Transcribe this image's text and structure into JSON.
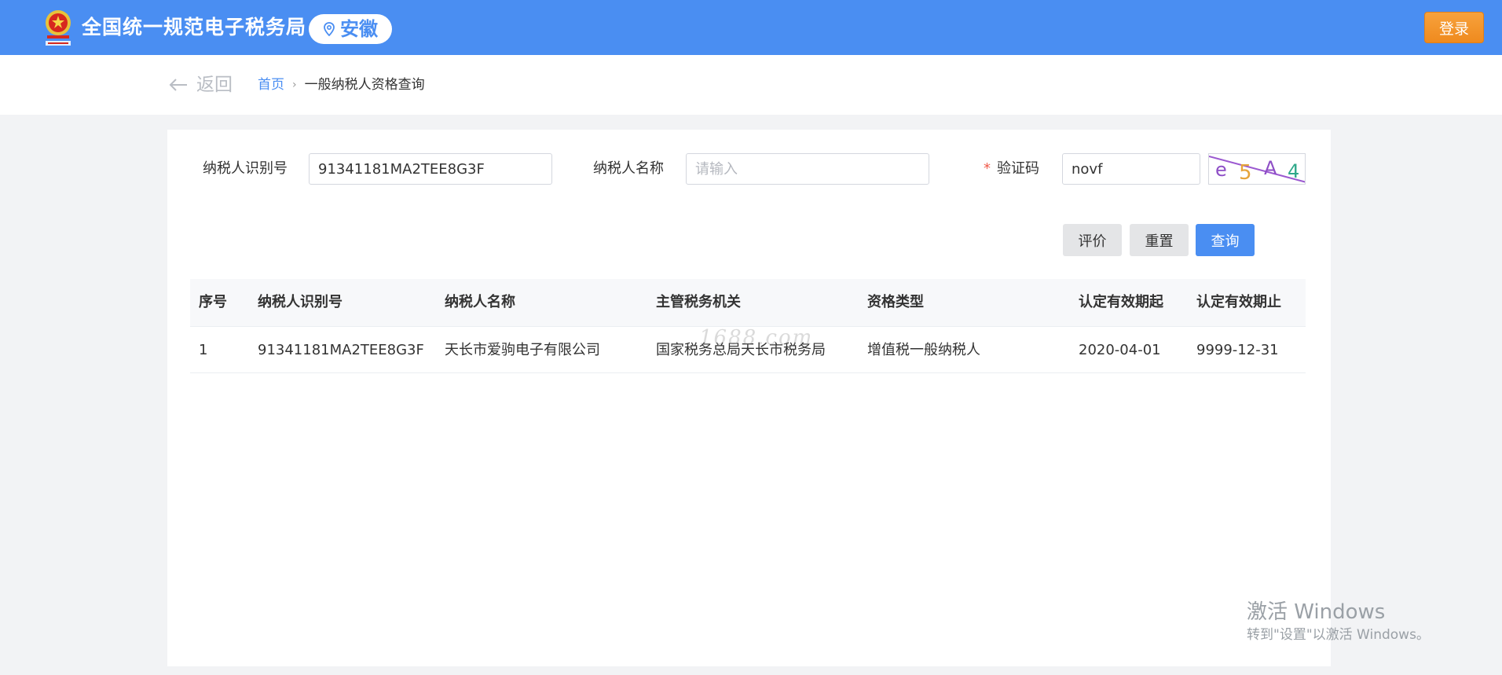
{
  "header": {
    "site_title": "全国统一规范电子税务局",
    "region": "安徽",
    "login_label": "登录"
  },
  "nav": {
    "back_label": "返回",
    "home_label": "首页",
    "separator": "›",
    "current_label": "一般纳税人资格查询"
  },
  "form": {
    "taxpayer_id_label": "纳税人识别号",
    "taxpayer_id_value": "91341181MA2TEE8G3F",
    "taxpayer_name_label": "纳税人名称",
    "taxpayer_name_placeholder": "请输入",
    "required_mark": "*",
    "captcha_label": "验证码",
    "captcha_value": "novf",
    "captcha_image_text": "e5A4"
  },
  "buttons": {
    "evaluate": "评价",
    "reset": "重置",
    "query": "查询"
  },
  "table": {
    "columns": [
      "序号",
      "纳税人识别号",
      "纳税人名称",
      "主管税务机关",
      "资格类型",
      "认定有效期起",
      "认定有效期止"
    ],
    "rows": [
      [
        "1",
        "91341181MA2TEE8G3F",
        "天长市爱驹电子有限公司",
        "国家税务总局天长市税务局",
        "增值税一般纳税人",
        "2020-04-01",
        "9999-12-31"
      ]
    ]
  },
  "overlays": {
    "image_watermark": "1688.com",
    "windows_activation_title": "激活 Windows",
    "windows_activation_hint": "转到\"设置\"以激活 Windows。"
  },
  "colors": {
    "brand_blue": "#4a8ef2",
    "login_orange": "#ef8a1e",
    "required_red": "#f05a4a"
  }
}
